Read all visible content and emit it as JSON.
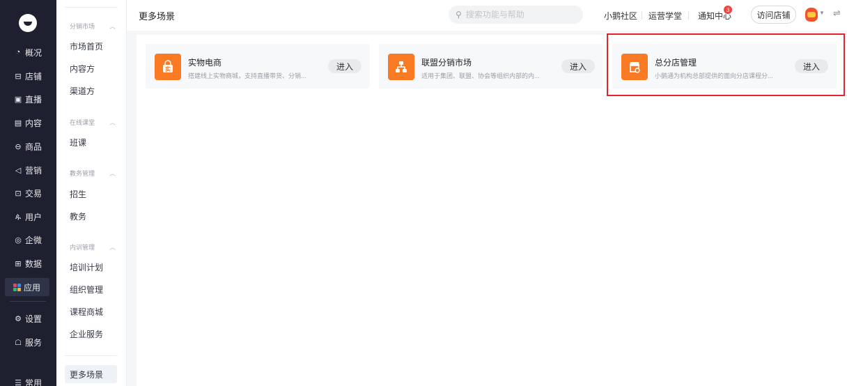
{
  "nav_primary": [
    {
      "label": "概况",
      "icon": "pie-chart-icon"
    },
    {
      "label": "店铺",
      "icon": "store-icon"
    },
    {
      "label": "直播",
      "icon": "live-icon"
    },
    {
      "label": "内容",
      "icon": "document-icon"
    },
    {
      "label": "商品",
      "icon": "box-icon"
    },
    {
      "label": "营销",
      "icon": "megaphone-icon"
    },
    {
      "label": "交易",
      "icon": "receipt-icon"
    },
    {
      "label": "用户",
      "icon": "user-icon"
    },
    {
      "label": "企微",
      "icon": "chat-icon"
    },
    {
      "label": "数据",
      "icon": "data-icon"
    },
    {
      "label": "应用",
      "icon": "apps-icon",
      "active": true
    },
    {
      "label": "设置",
      "icon": "gear-icon"
    },
    {
      "label": "服务",
      "icon": "service-icon"
    },
    {
      "label": "常用",
      "icon": "menu-icon"
    }
  ],
  "nav_secondary": {
    "groups": [
      {
        "title": "分销市场",
        "items": [
          "市场首页",
          "内容方",
          "渠道方"
        ]
      },
      {
        "title": "在线课堂",
        "items": [
          "班课"
        ]
      },
      {
        "title": "教务管理",
        "items": [
          "招生",
          "教务"
        ]
      },
      {
        "title": "内训管理",
        "items": [
          "培训计划",
          "组织管理",
          "课程商城",
          "企业服务"
        ]
      }
    ],
    "active_item": "更多场景"
  },
  "header": {
    "title": "更多场景",
    "search_placeholder": "搜索功能与帮助",
    "links": [
      "小鹅社区",
      "运营学堂",
      "通知中心"
    ],
    "notification_count": "3",
    "visit_store_label": "访问店铺"
  },
  "cards": [
    {
      "title": "实物电商",
      "desc": "搭建线上实物商城，支持直播带货、分销...",
      "enter": "进入",
      "icon": "shopping-bag-icon"
    },
    {
      "title": "联盟分销市场",
      "desc": "适用于集团、联盟、协会等组织内部的内...",
      "enter": "进入",
      "icon": "network-icon"
    },
    {
      "title": "总分店管理",
      "desc": "小鹅通为机构总部提供的面向分店课程分...",
      "enter": "进入",
      "icon": "storefront-icon"
    }
  ],
  "colors": {
    "sidebar_bg": "#1e2030",
    "card_icon": "#fa7a24",
    "highlight": "#e3232d",
    "badge": "#f5433f"
  }
}
